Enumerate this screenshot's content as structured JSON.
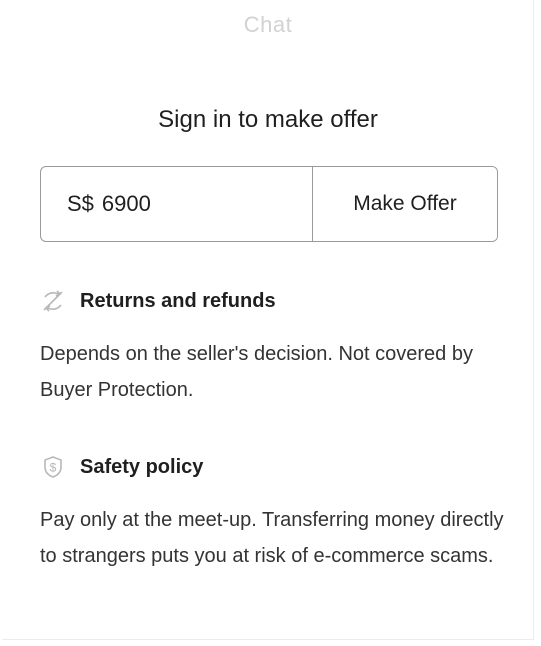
{
  "tabs": {
    "chat": "Chat"
  },
  "offer": {
    "title": "Sign in to make offer",
    "currency": "S$",
    "price_value": "6900",
    "button_label": "Make Offer"
  },
  "policies": {
    "returns": {
      "icon": "no-return-icon",
      "title": "Returns and refunds",
      "text": "Depends on the seller's decision. Not covered by Buyer Protection."
    },
    "safety": {
      "icon": "dollar-shield-icon",
      "title": "Safety policy",
      "text": "Pay only at the meet-up. Transferring money directly to strangers puts you at risk of e-commerce scams."
    }
  },
  "colors": {
    "border": "#9a9a9a",
    "muted_tab": "#d2d2d2",
    "text": "#1f1f1f"
  }
}
